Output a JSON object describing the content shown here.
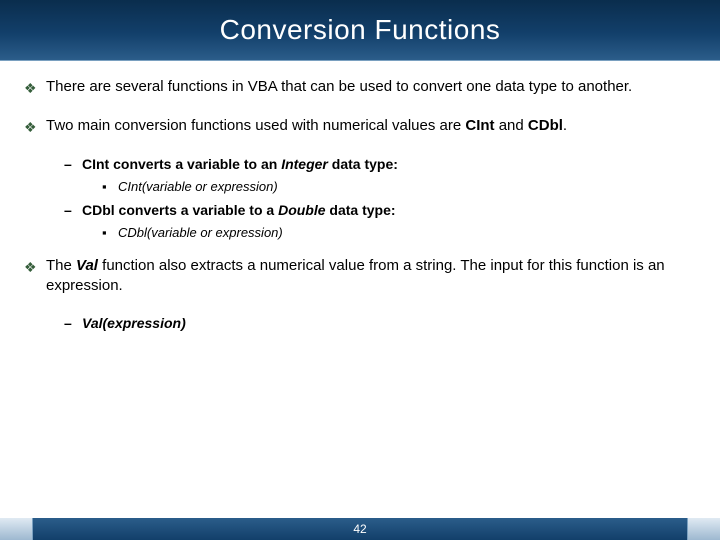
{
  "title": "Conversion Functions",
  "bullets": {
    "b1": "There are several functions in VBA that can be used to convert one data type to another.",
    "b2_a": "Two main conversion functions used with numerical values are ",
    "b2_b": "CInt",
    "b2_c": " and ",
    "b2_d": "CDbl",
    "b2_e": ".",
    "b2_1_a": "CInt",
    "b2_1_b": " converts a variable to an ",
    "b2_1_c": "Integer",
    "b2_1_d": " data type:",
    "b2_1_1": "CInt(variable or  expression)",
    "b2_2_a": "CDbl",
    "b2_2_b": " converts a variable to a ",
    "b2_2_c": "Double",
    "b2_2_d": " data type:",
    "b2_2_1": "CDbl(variable or  expression)",
    "b3_a": "The ",
    "b3_b": "Val",
    "b3_c": " function also extracts a numerical value from a string. The input for this function is an expression.",
    "b3_1": "Val(expression)"
  },
  "page_number": "42"
}
